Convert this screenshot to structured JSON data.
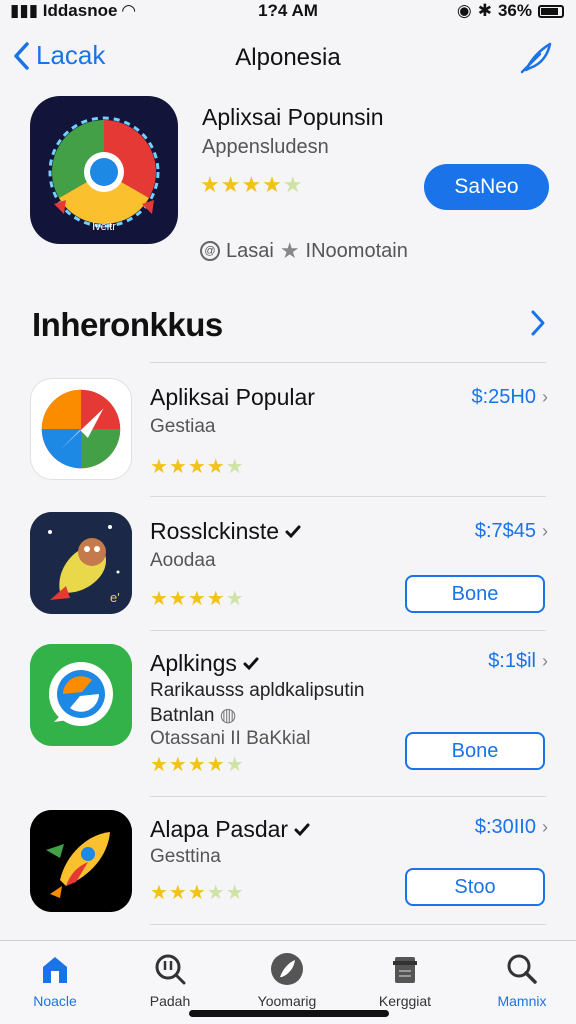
{
  "status_bar": {
    "carrier": "Iddasnoe",
    "time": "1?4 AM",
    "battery": "36%"
  },
  "nav": {
    "back_label": "Lacak",
    "title": "Alponesia"
  },
  "hero": {
    "title": "Aplixsai Popunsin",
    "subtitle": "Appensludesn",
    "rating_stars": 4,
    "button_label": "SaNeo",
    "meta_left": "Lasai",
    "meta_right": "INoomotain",
    "icon_text": "Iveitr"
  },
  "section": {
    "title": "Inheronkkus"
  },
  "apps": [
    {
      "title": "Apliksai Popular",
      "subtitle": "Gestiaa",
      "price": "$:25H0",
      "stars": 4
    },
    {
      "title": "Rosslckinste",
      "subtitle": "Aoodaa",
      "price": "$:7$45",
      "button": "Bone",
      "stars": 4
    },
    {
      "title": "Aplkings",
      "desc_line1": "Rarikausss apldkalipsutin",
      "desc_line2": "Batnlan",
      "subtitle": "Otassani II BaKkial",
      "price": "$:1$il",
      "button": "Bone",
      "stars": 4
    },
    {
      "title": "Alapa Pasdar",
      "subtitle": "Gesttina",
      "price": "$:30II0",
      "button": "Stoo",
      "stars": 3
    }
  ],
  "tabs": [
    {
      "label": "Noacle",
      "icon": "home-icon",
      "active": true
    },
    {
      "label": "Padah",
      "icon": "search-alert-icon",
      "active": false
    },
    {
      "label": "Yoomarig",
      "icon": "feather-icon",
      "active": false
    },
    {
      "label": "Kerggiat",
      "icon": "document-icon",
      "active": false
    },
    {
      "label": "Mamnix",
      "icon": "search-icon",
      "active": false
    }
  ],
  "colors": {
    "accent": "#1a73e8",
    "star": "#f2c21b"
  }
}
